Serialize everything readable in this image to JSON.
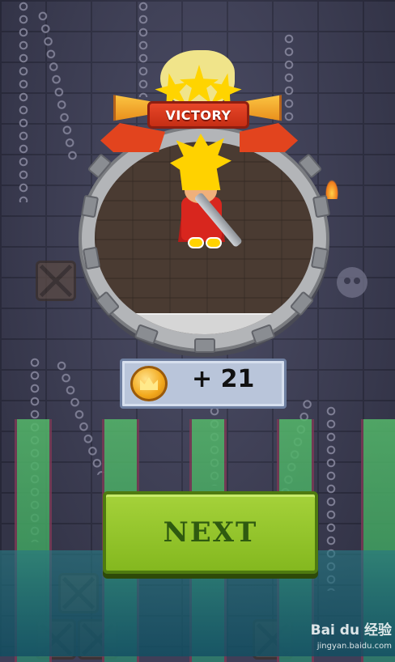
{
  "banner": {
    "title": "VICTORY"
  },
  "reward": {
    "amount": "+ 21",
    "icon": "coin-crown-icon"
  },
  "buttons": {
    "next_label": "NEXT"
  },
  "watermark": {
    "brand": "Bai du 经验",
    "url": "jingyan.baidu.com"
  },
  "colors": {
    "background": "#44455f",
    "banner_red": "#e74628",
    "star_yellow": "#ffd400",
    "next_green": "#a5d23a",
    "next_text": "#2f5a10",
    "reward_panel": "#b9c5da"
  }
}
